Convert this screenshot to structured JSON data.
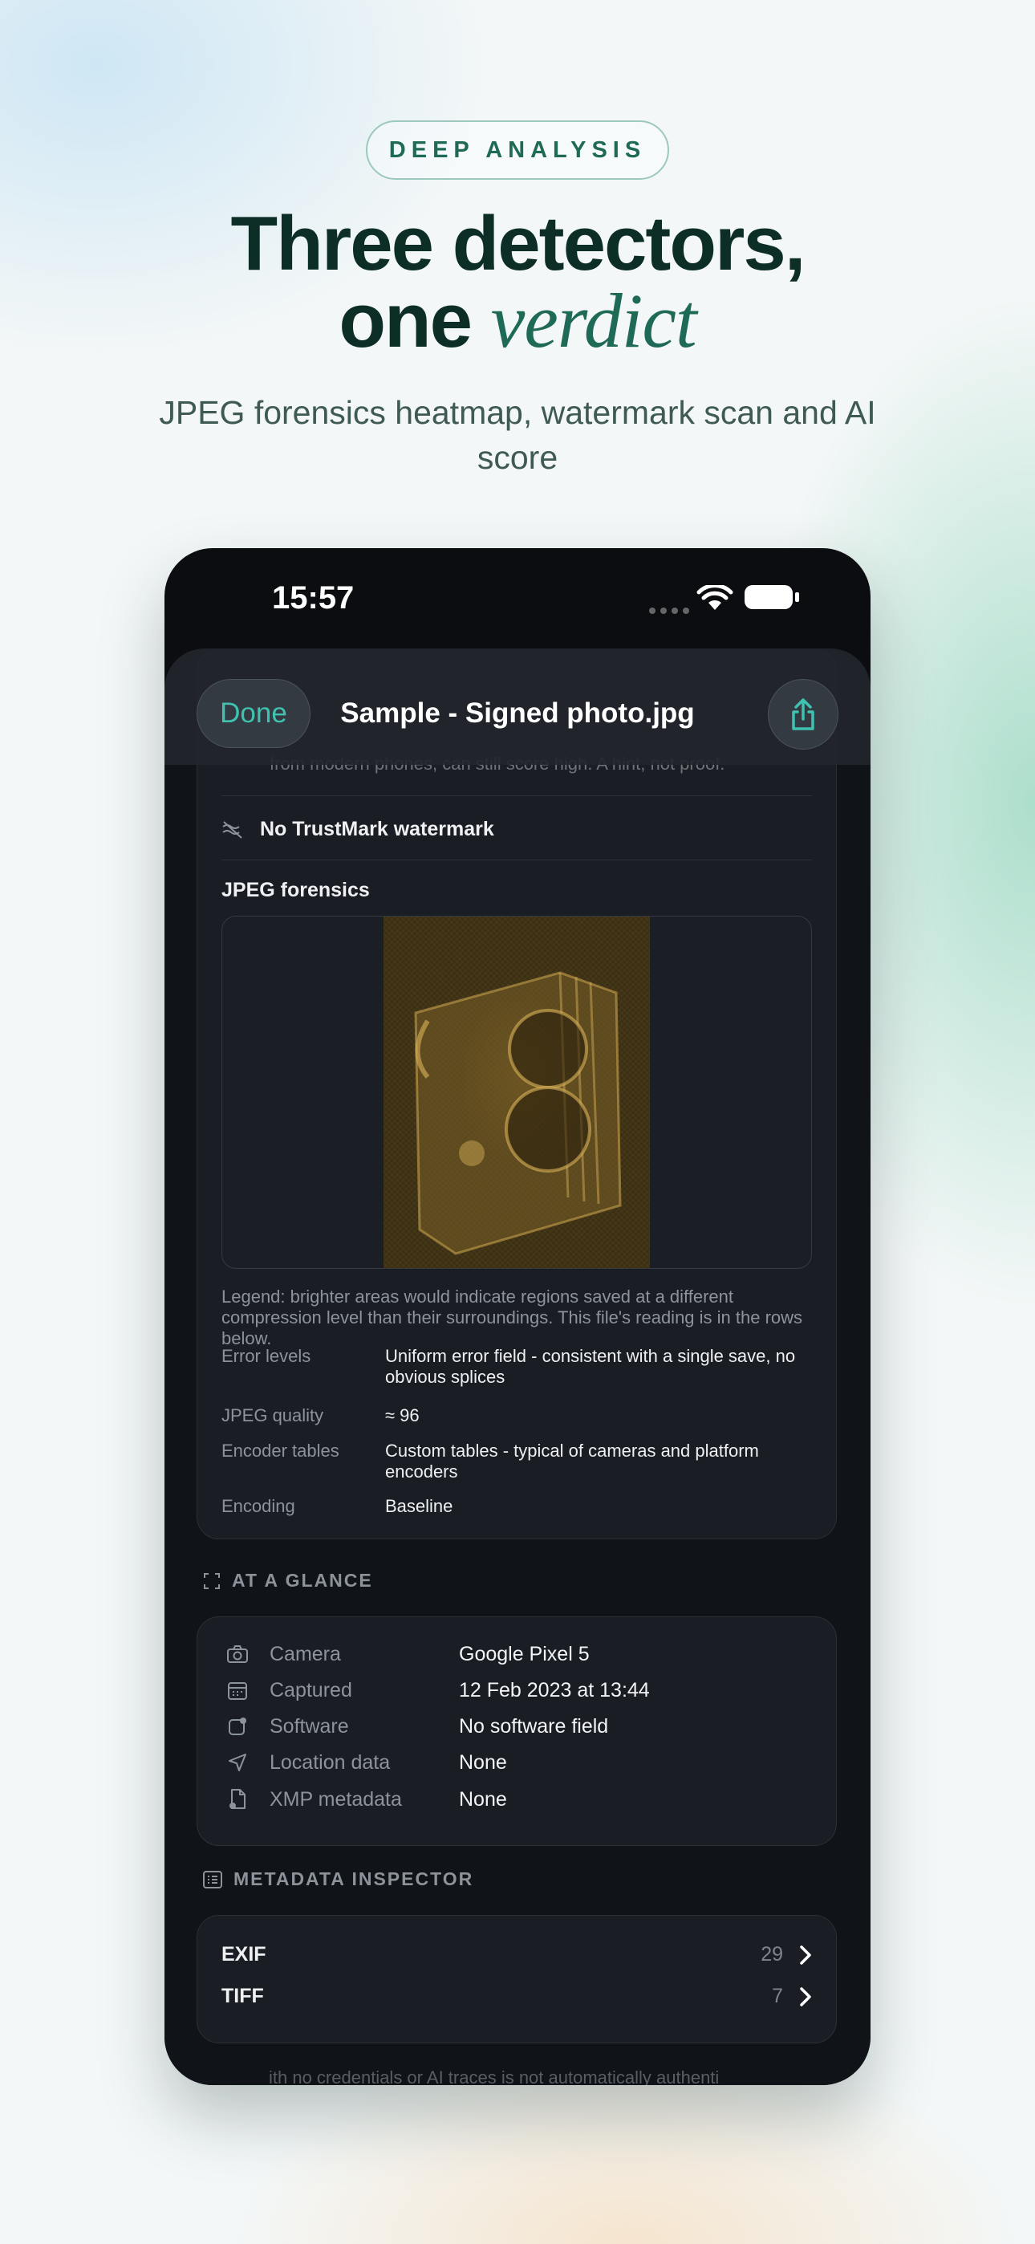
{
  "hero": {
    "pill": "DEEP ANALYSIS",
    "headline_line1": "Three detectors,",
    "headline_line2_a": "one",
    "headline_line2_b": "verdict",
    "subtitle": "JPEG forensics heatmap, watermark scan and AI score"
  },
  "status": {
    "time": "15:57"
  },
  "navbar": {
    "done_label": "Done",
    "title": "Sample - Signed photo.jpg",
    "share_icon": "share-icon"
  },
  "scrolled_text": {
    "top_line": "from modern phones, can still score high. A hint, not proof.",
    "bottom_line": "ith no credentials or AI traces is not automatically authenti"
  },
  "trustmark": {
    "icon": "no-watermark-icon",
    "label": "No TrustMark watermark"
  },
  "jpeg_forensics": {
    "title": "JPEG forensics",
    "legend": "Legend: brighter areas would indicate regions saved at a different compression level than their surroundings. This file's reading is in the rows below.",
    "rows": [
      {
        "key": "Error levels",
        "value": "Uniform error field - consistent with a single save, no obvious splices"
      },
      {
        "key": "JPEG quality",
        "value": "≈ 96"
      },
      {
        "key": "Encoder tables",
        "value": "Custom tables - typical of cameras and platform encoders"
      },
      {
        "key": "Encoding",
        "value": "Baseline"
      }
    ]
  },
  "at_a_glance": {
    "heading": "AT A GLANCE",
    "rows": [
      {
        "icon": "camera-icon",
        "key": "Camera",
        "value": "Google Pixel 5"
      },
      {
        "icon": "calendar-icon",
        "key": "Captured",
        "value": "12 Feb 2023 at 13:44"
      },
      {
        "icon": "software-icon",
        "key": "Software",
        "value": "No software field"
      },
      {
        "icon": "location-icon",
        "key": "Location data",
        "value": "None"
      },
      {
        "icon": "xmp-file-icon",
        "key": "XMP metadata",
        "value": "None"
      }
    ]
  },
  "metadata_inspector": {
    "heading": "METADATA INSPECTOR",
    "rows": [
      {
        "key": "EXIF",
        "count": "29"
      },
      {
        "key": "TIFF",
        "count": "7"
      }
    ]
  },
  "colors": {
    "accent": "#3fc2b0",
    "brand_green": "#1f6a56",
    "dark_bg": "#101317",
    "card_bg": "#1a1e24"
  }
}
